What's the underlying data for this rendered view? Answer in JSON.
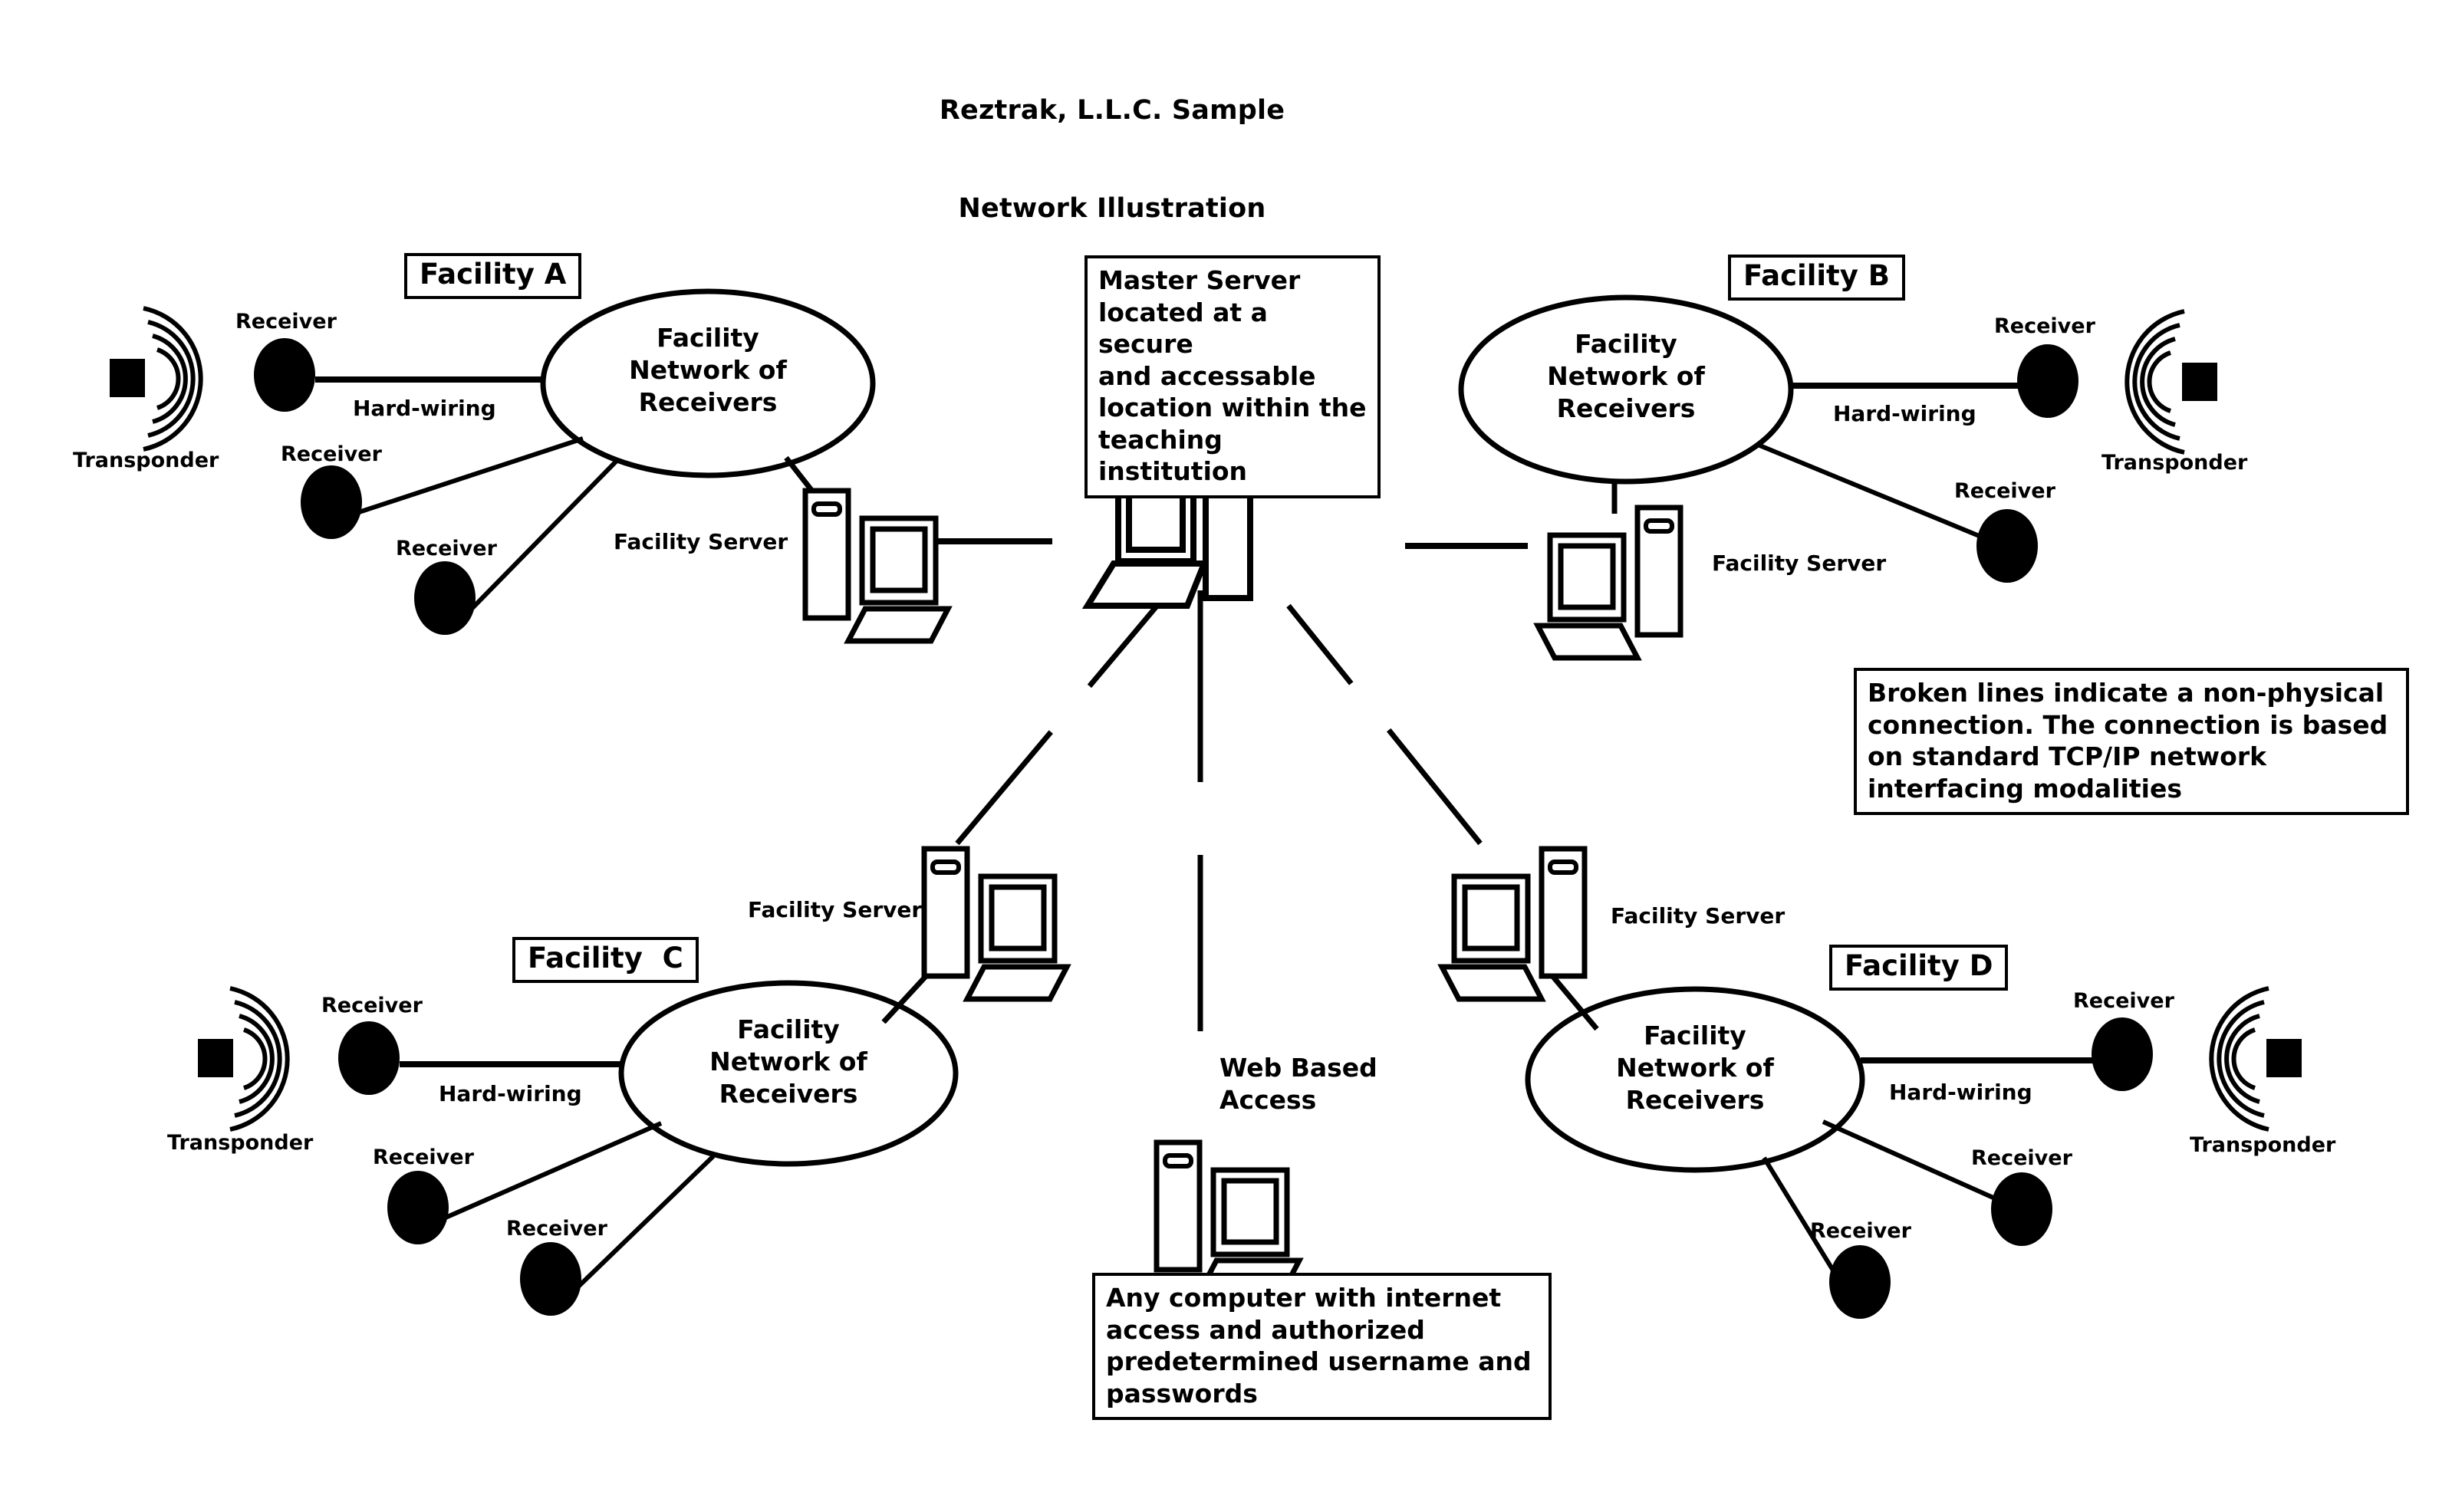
{
  "title": {
    "line1": "Reztrak, L.L.C. Sample",
    "line2": "Network Illustration"
  },
  "notes": {
    "master_server": "Master Server\nlocated at a secure\nand accessable\nlocation within the\nteaching institution",
    "broken_lines": "Broken lines indicate a non-physical\nconnection.  The connection is based\non standard TCP/IP network\ninterfacing modalities",
    "web_access": "Any computer with internet\naccess and authorized\npredetermined username and\npasswords"
  },
  "web_access_node": {
    "label": "Web Based\nAccess"
  },
  "common": {
    "receiver": "Receiver",
    "transponder": "Transponder",
    "hard_wiring": "Hard-wiring",
    "facility_server": "Facility Server",
    "cloud_label": "Facility\nNetwork of\nReceivers"
  },
  "facilities": [
    {
      "id": "a",
      "tag": "Facility A",
      "cloud_label": "Facility\nNetwork of\nReceivers",
      "server_label": "Facility Server",
      "hard_wiring_label": "Hard-wiring",
      "transponder_label": "Transponder",
      "receivers": [
        {
          "label": "Receiver"
        },
        {
          "label": "Receiver"
        },
        {
          "label": "Receiver"
        }
      ]
    },
    {
      "id": "b",
      "tag": "Facility B",
      "cloud_label": "Facility\nNetwork of\nReceivers",
      "server_label": "Facility Server",
      "hard_wiring_label": "Hard-wiring",
      "transponder_label": "Transponder",
      "receivers": [
        {
          "label": "Receiver"
        },
        {
          "label": "Receiver"
        }
      ]
    },
    {
      "id": "c",
      "tag": "Facility  C",
      "cloud_label": "Facility\nNetwork of\nReceivers",
      "server_label": "Facility Server",
      "hard_wiring_label": "Hard-wiring",
      "transponder_label": "Transponder",
      "receivers": [
        {
          "label": "Receiver"
        },
        {
          "label": "Receiver"
        },
        {
          "label": "Receiver"
        }
      ]
    },
    {
      "id": "d",
      "tag": "Facility D",
      "cloud_label": "Facility\nNetwork of\nReceivers",
      "server_label": "Facility Server",
      "hard_wiring_label": "Hard-wiring",
      "transponder_label": "Transponder",
      "receivers": [
        {
          "label": "Receiver"
        },
        {
          "label": "Receiver"
        },
        {
          "label": "Receiver"
        }
      ]
    }
  ],
  "colors": {
    "ink": "#000000",
    "paper": "#ffffff"
  }
}
